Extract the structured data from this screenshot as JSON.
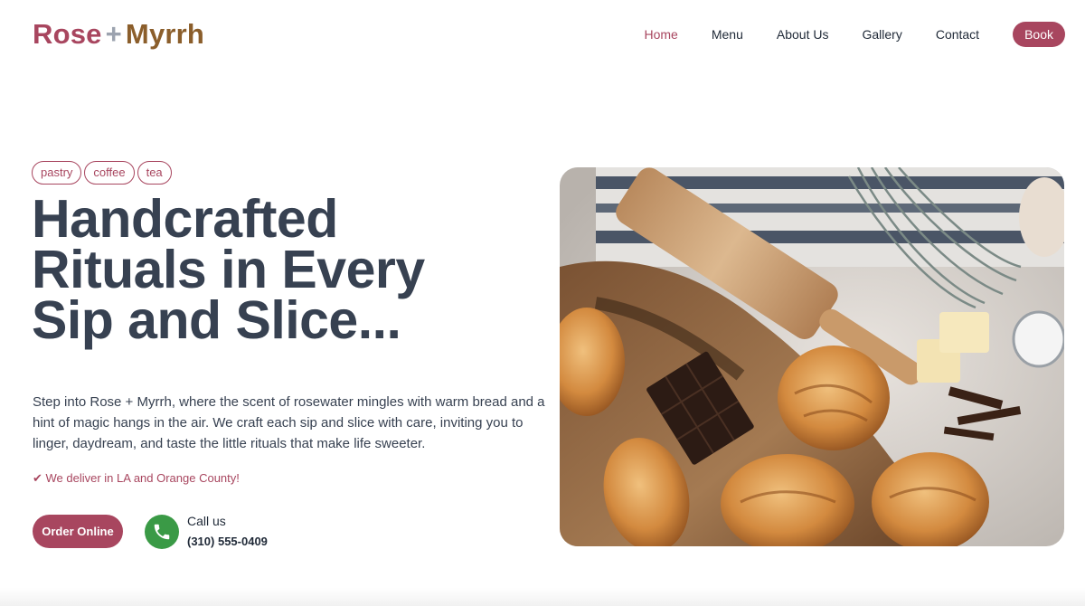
{
  "brand": {
    "name_part1": "Rose",
    "plus": "+",
    "name_part2": "Myrrh"
  },
  "nav": {
    "items": [
      {
        "label": "Home",
        "active": true
      },
      {
        "label": "Menu",
        "active": false
      },
      {
        "label": "About Us",
        "active": false
      },
      {
        "label": "Gallery",
        "active": false
      },
      {
        "label": "Contact",
        "active": false
      }
    ],
    "book_label": "Book"
  },
  "hero": {
    "tags": [
      "pastry",
      "coffee",
      "tea"
    ],
    "headline_lines": [
      "Handcrafted",
      "Rituals in Every",
      "Sip and Slice..."
    ],
    "description": "Step into Rose + Myrrh, where the scent of rosewater mingles with warm bread and a hint of magic hangs in the air. We craft each sip and slice with care, inviting you to linger, daydream, and taste the little rituals that make life sweeter.",
    "delivery_note": "✔ We deliver in LA and Orange County!",
    "order_label": "Order Online",
    "call_label": "Call us",
    "phone": "(310) 555-0409"
  },
  "colors": {
    "accent": "#a8465f",
    "brand_secondary": "#8b5e2b",
    "phone_green": "#3a9a46",
    "heading": "#374151"
  },
  "icons": {
    "phone": "phone-icon"
  }
}
